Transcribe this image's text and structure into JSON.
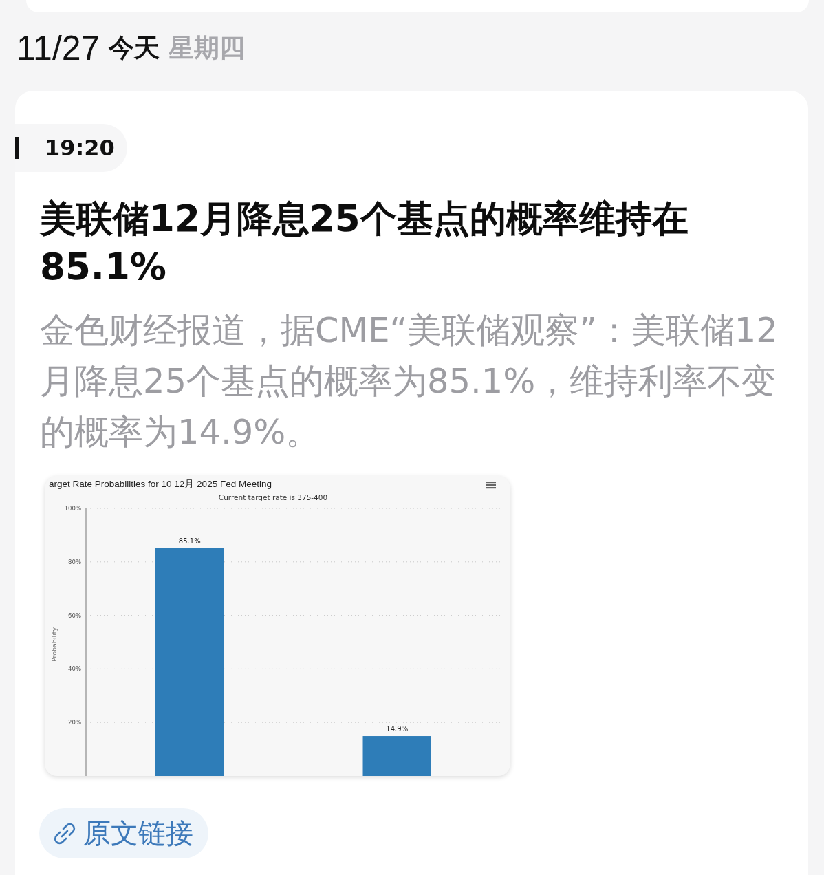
{
  "date_header": {
    "date": "11/27",
    "relative_day": "今天",
    "weekday": "星期四"
  },
  "news_item": {
    "time": "19:20",
    "title": "美联储12月降息25个基点的概率维持在85.1%",
    "body": "金色财经报道，据CME“美联储观察”：美联储12月降息25个基点的概率为85.1%，维持利率不变的概率为14.9%。",
    "chart": {
      "subtitle": "Current target rate is 375-400",
      "chart_data": {
        "type": "bar",
        "title": "arget Rate Probabilities for 10 12月 2025 Fed Meeting",
        "ylabel": "Probability",
        "values": [
          85.1,
          14.9
        ],
        "ylim": [
          0,
          100
        ],
        "yticks": [
          {
            "value": 20,
            "label": "20%"
          },
          {
            "value": 40,
            "label": "40%"
          },
          {
            "value": 60,
            "label": "60%"
          },
          {
            "value": 80,
            "label": "80%"
          },
          {
            "value": 100,
            "label": "100%"
          }
        ],
        "grid": true,
        "value_labels": [
          "85.1%",
          "14.9%"
        ]
      }
    },
    "source_link": {
      "label": "原文链接"
    }
  }
}
